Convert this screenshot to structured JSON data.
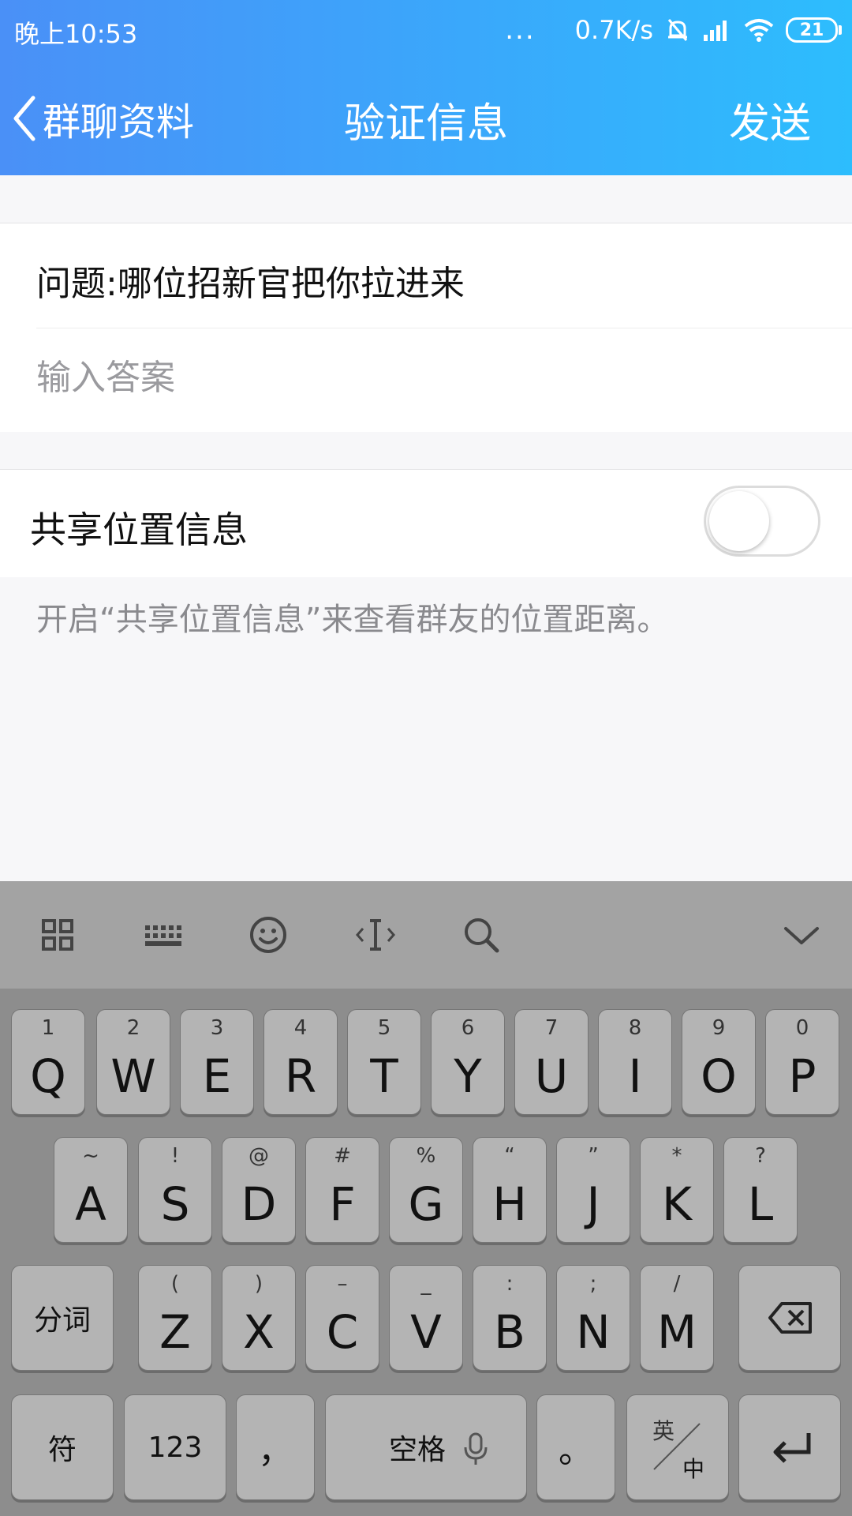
{
  "status_bar": {
    "time": "晚上10:53",
    "dots": "...",
    "speed": "0.7K/s",
    "battery": "21"
  },
  "navbar": {
    "back_label": "群聊资料",
    "title": "验证信息",
    "send_label": "发送"
  },
  "question": {
    "text": "问题:哪位招新官把你拉进来",
    "answer_placeholder": "输入答案",
    "answer_value": ""
  },
  "location": {
    "label": "共享位置信息",
    "enabled": false,
    "hint": "开启“共享位置信息”来查看群友的位置距离。"
  },
  "keyboard": {
    "toolbar": [
      "grid-icon",
      "keyboard-icon",
      "emoji-icon",
      "cursor-icon",
      "search-icon",
      "collapse-icon"
    ],
    "row1": [
      {
        "sub": "1",
        "main": "Q"
      },
      {
        "sub": "2",
        "main": "W"
      },
      {
        "sub": "3",
        "main": "E"
      },
      {
        "sub": "4",
        "main": "R"
      },
      {
        "sub": "5",
        "main": "T"
      },
      {
        "sub": "6",
        "main": "Y"
      },
      {
        "sub": "7",
        "main": "U"
      },
      {
        "sub": "8",
        "main": "I"
      },
      {
        "sub": "9",
        "main": "O"
      },
      {
        "sub": "0",
        "main": "P"
      }
    ],
    "row2": [
      {
        "sub": "~",
        "main": "A"
      },
      {
        "sub": "!",
        "main": "S"
      },
      {
        "sub": "@",
        "main": "D"
      },
      {
        "sub": "#",
        "main": "F"
      },
      {
        "sub": "%",
        "main": "G"
      },
      {
        "sub": "“",
        "main": "H"
      },
      {
        "sub": "”",
        "main": "J"
      },
      {
        "sub": "*",
        "main": "K"
      },
      {
        "sub": "?",
        "main": "L"
      }
    ],
    "row3": [
      {
        "sub": "(",
        "main": "Z"
      },
      {
        "sub": ")",
        "main": "X"
      },
      {
        "sub": "–",
        "main": "C"
      },
      {
        "sub": "_",
        "main": "V"
      },
      {
        "sub": ":",
        "main": "B"
      },
      {
        "sub": ";",
        "main": "N"
      },
      {
        "sub": "/",
        "main": "M"
      }
    ],
    "fenci": "分词",
    "symbols": "符",
    "numbers": "123",
    "comma": "，",
    "space": "空格",
    "period": "。",
    "lang_top": "英",
    "lang_bottom": "中"
  }
}
